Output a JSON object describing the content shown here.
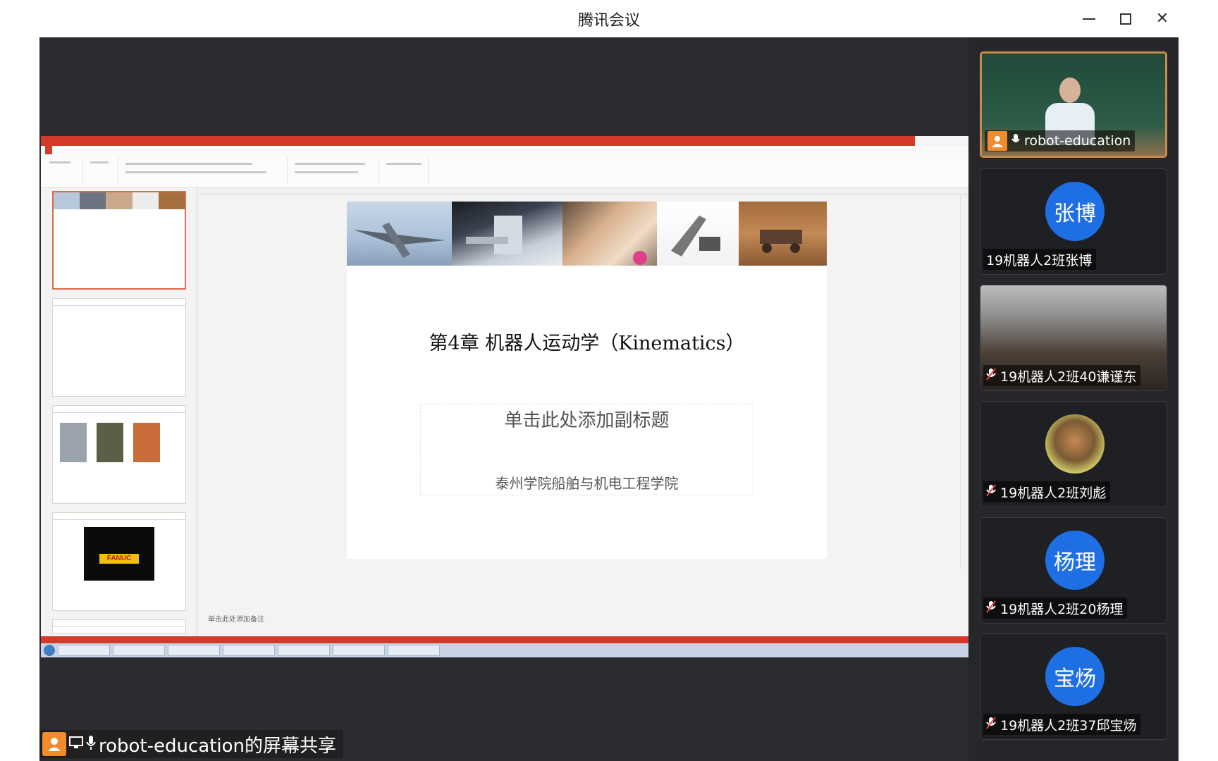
{
  "window": {
    "title": "腾讯会议",
    "controls": {
      "minimize_icon": "minimize-icon",
      "maximize_icon": "maximize-icon",
      "close_icon": "close-icon",
      "close_glyph": "✕"
    }
  },
  "shared_screen": {
    "label": "robot-education的屏幕共享",
    "slide": {
      "title": "第4章 机器人运动学（Kinematics）",
      "subtitle": "单击此处添加副标题",
      "school": "泰州学院船舶与机电工程学院"
    },
    "notes_placeholder": "单击此处添加备注",
    "fanuc_logo": "FANUC"
  },
  "participants": [
    {
      "name": "robot-education",
      "type": "video",
      "audio": "on",
      "speaking": true,
      "icon": "mic-icon"
    },
    {
      "avatar_text": "张博",
      "name": "19机器人2班张博",
      "type": "avatar",
      "audio": "none"
    },
    {
      "name": "19机器人2班40谦谨东",
      "type": "video",
      "audio": "muted",
      "icon": "mic-muted-icon"
    },
    {
      "name": "19机器人2班刘彪",
      "type": "photo",
      "audio": "muted",
      "icon": "mic-muted-icon"
    },
    {
      "avatar_text": "杨理",
      "name": "19机器人2班20杨理",
      "type": "avatar",
      "audio": "muted",
      "icon": "mic-muted-icon"
    },
    {
      "avatar_text": "宝炀",
      "name": "19机器人2班37邱宝炀",
      "type": "avatar",
      "audio": "muted",
      "icon": "mic-muted-icon"
    }
  ],
  "colors": {
    "accent_blue": "#1f6fe4",
    "ppt_red": "#d33a2c",
    "speaking_border": "#c88b4a",
    "avatar_orange": "#f28a2e"
  }
}
